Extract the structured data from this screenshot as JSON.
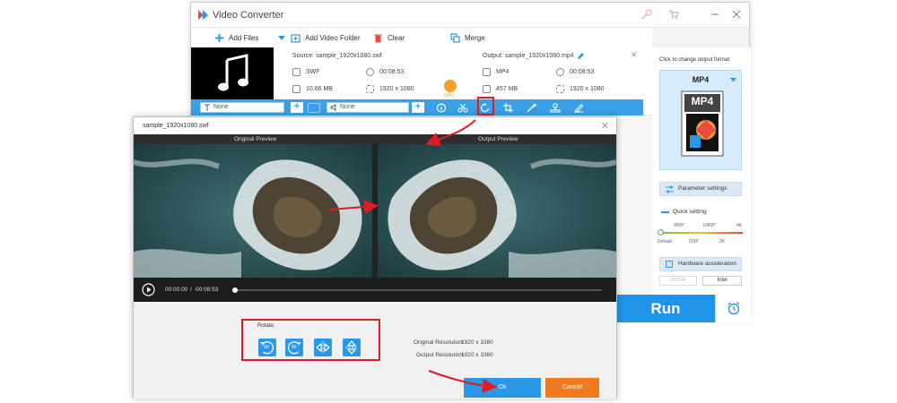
{
  "app": {
    "title": "Video Converter"
  },
  "toolbar": {
    "add_files": "Add Files",
    "add_folder": "Add Video Folder",
    "clear": "Clear",
    "merge": "Merge"
  },
  "file": {
    "source_name": "Source: sample_1920x1080.swf",
    "output_name": "Output: sample_1920x1080.mp4",
    "src_format": "SWF",
    "src_duration": "00:08:53",
    "src_size": "10.66 MB",
    "src_resolution": "1920 x 1080",
    "out_format": "MP4",
    "out_duration": "00:08:53",
    "out_size": "457 MB",
    "out_resolution": "1920 x 1080",
    "gpu_badge": "GPU"
  },
  "edit_bar": {
    "subtitle_value": "None",
    "audio_value": "None"
  },
  "right_panel": {
    "format_hint": "Click to change output format:",
    "format": "MP4",
    "format_box_text": "MP4",
    "parameter_settings": "Parameter settings",
    "quick_setting": "Quick setting",
    "slider_top": [
      "480P",
      "1080P",
      "4K"
    ],
    "slider_bottom": [
      "Default",
      "720P",
      "2K"
    ],
    "hw_accel": "Hardware acceleration",
    "nvidia": "NVIDIA",
    "intel": "Intel",
    "run": "Run"
  },
  "dialog": {
    "title": "sample_1920x1080.swf",
    "original_preview": "Original Preview",
    "output_preview": "Output Preview",
    "time_current": "00:00:00",
    "time_sep": "/",
    "time_total": "00:08:53",
    "rotate_label": "Rotate:",
    "rot90_left": "90",
    "rot90_right": "90",
    "original_resolution_label": "Original Resolution:",
    "original_resolution": "1920 x 1080",
    "output_resolution_label": "Output Resolution:",
    "output_resolution": "1920 x 1080",
    "ok": "Ok",
    "cancel": "Cancel"
  },
  "colors": {
    "accent": "#2b98e6",
    "highlight": "#e01b24",
    "cancel": "#f07a1e"
  },
  "icons": [
    "app-logo-icon",
    "key-icon",
    "cart-icon",
    "minimize-icon",
    "close-icon",
    "plus-icon",
    "folder-icon",
    "trash-icon",
    "merge-icon",
    "music-note-icon",
    "edit-icon",
    "text-icon",
    "speaker-icon",
    "info-icon",
    "cut-icon",
    "rotate-icon",
    "crop-icon",
    "effects-icon",
    "watermark-icon",
    "subtitle-edit-icon",
    "alarm-icon",
    "play-icon",
    "rotate-left-icon",
    "rotate-right-icon",
    "flip-horizontal-icon",
    "flip-vertical-icon"
  ]
}
